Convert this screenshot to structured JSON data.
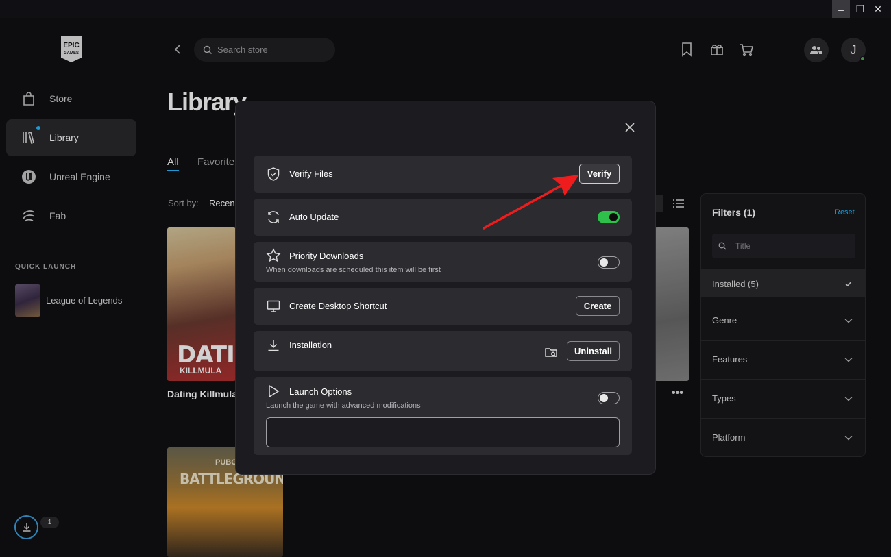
{
  "window": {
    "minimize": "–",
    "maximize": "❐",
    "close": "✕"
  },
  "sidebar": {
    "logo": "EPIC GAMES",
    "items": [
      {
        "label": "Store",
        "icon": "shopping-bag-icon"
      },
      {
        "label": "Library",
        "icon": "library-icon",
        "active": true
      },
      {
        "label": "Unreal Engine",
        "icon": "unreal-engine-icon"
      },
      {
        "label": "Fab",
        "icon": "fab-icon"
      }
    ],
    "quick_launch_title": "QUICK LAUNCH",
    "quick_launch_items": [
      {
        "label": "League of Legends"
      }
    ],
    "download_count": "1"
  },
  "topbar": {
    "search_placeholder": "Search store",
    "avatar_initial": "J"
  },
  "library": {
    "title": "Library",
    "tabs": [
      "All",
      "Favorite"
    ],
    "sort_label": "Sort by:",
    "sort_value": "Recen",
    "cards": [
      {
        "title": "Dating Killmula",
        "art_text": "DATI",
        "art_sub": "KILLMULA"
      },
      {
        "title": "",
        "art_text": "BATTLEGROUNDS",
        "art_sub": "PUBG"
      }
    ],
    "more": "•••"
  },
  "filters": {
    "title": "Filters (1)",
    "reset": "Reset",
    "search_placeholder": "Title",
    "rows": [
      {
        "label": "Installed (5)",
        "selected": true
      },
      {
        "label": "Genre"
      },
      {
        "label": "Features"
      },
      {
        "label": "Types"
      },
      {
        "label": "Platform"
      }
    ]
  },
  "modal": {
    "verify": {
      "title": "Verify Files",
      "button": "Verify"
    },
    "auto_update": {
      "title": "Auto Update",
      "enabled": true
    },
    "priority": {
      "title": "Priority Downloads",
      "desc": "When downloads are scheduled this item will be first",
      "enabled": false
    },
    "shortcut": {
      "title": "Create Desktop Shortcut",
      "button": "Create"
    },
    "installation": {
      "title": "Installation",
      "button": "Uninstall"
    },
    "launch": {
      "title": "Launch Options",
      "desc": "Launch the game with advanced modifications",
      "enabled": false,
      "value": ""
    }
  },
  "colors": {
    "accent": "#26bbff",
    "toggle_on": "#2ec04a",
    "arrow": "#ee1c1c"
  }
}
